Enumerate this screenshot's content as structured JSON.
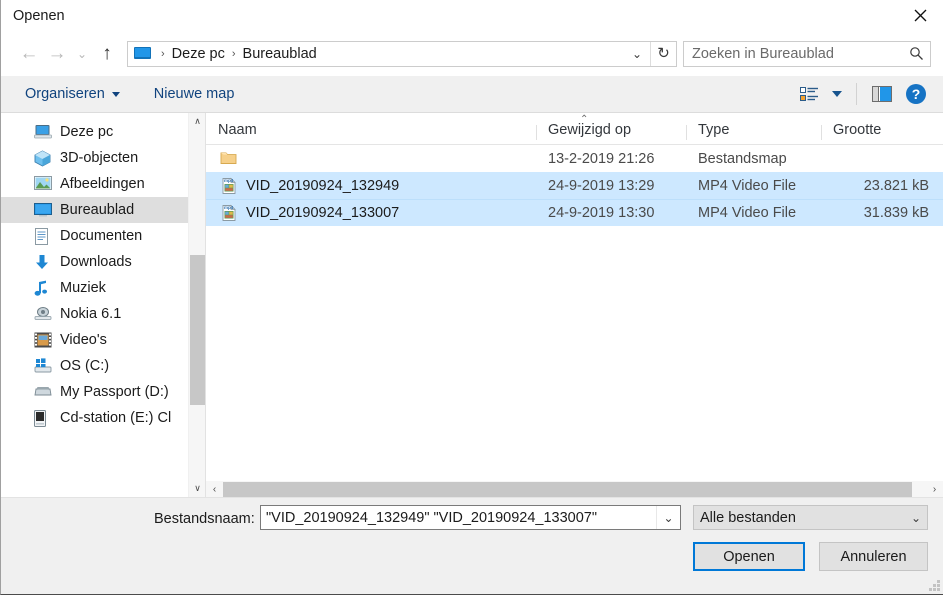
{
  "window": {
    "title": "Openen",
    "close_label": "✕"
  },
  "nav": {
    "back": {
      "glyph": "←",
      "name": "back-button",
      "enabled": false
    },
    "forward": {
      "glyph": "→",
      "name": "forward-button",
      "enabled": false
    },
    "recent": {
      "glyph": "⌵",
      "name": "recent-locations-button",
      "enabled": false
    },
    "up": {
      "glyph": "↑",
      "name": "up-button",
      "enabled": true
    }
  },
  "address": {
    "icon": "desktop-icon",
    "crumbs": [
      "Deze pc",
      "Bureaublad"
    ],
    "separator": "›",
    "dropdown_glyph": "⌵",
    "refresh_glyph": "↻"
  },
  "search": {
    "placeholder": "Zoeken in Bureaublad",
    "icon": "search-icon"
  },
  "commandbar": {
    "organize_label": "Organiseren",
    "new_folder_label": "Nieuwe map",
    "view_icon": "list-view-icon",
    "view_caret": "▼",
    "preview_icon": "preview-pane-icon",
    "help_icon": "help-icon",
    "help_glyph": "?"
  },
  "sidebar": {
    "items": [
      {
        "label": "Deze pc",
        "icon": "this-pc-icon",
        "selected": false
      },
      {
        "label": "3D-objecten",
        "icon": "3d-objects-icon",
        "selected": false
      },
      {
        "label": "Afbeeldingen",
        "icon": "pictures-icon",
        "selected": false
      },
      {
        "label": "Bureaublad",
        "icon": "desktop-icon",
        "selected": true
      },
      {
        "label": "Documenten",
        "icon": "documents-icon",
        "selected": false
      },
      {
        "label": "Downloads",
        "icon": "downloads-icon",
        "selected": false
      },
      {
        "label": "Muziek",
        "icon": "music-icon",
        "selected": false
      },
      {
        "label": "Nokia 6.1",
        "icon": "phone-icon",
        "selected": false
      },
      {
        "label": "Video's",
        "icon": "videos-icon",
        "selected": false
      },
      {
        "label": "OS (C:)",
        "icon": "windows-drive-icon",
        "selected": false
      },
      {
        "label": "My Passport (D:)",
        "icon": "external-drive-icon",
        "selected": false
      },
      {
        "label": "Cd-station (E:) Cl",
        "icon": "cd-drive-icon",
        "selected": false
      }
    ],
    "scrollbar": {
      "up_glyph": "∧",
      "down_glyph": "∨",
      "thumb_top_pct": 37,
      "thumb_height_pct": 39
    }
  },
  "filelist": {
    "columns": [
      {
        "key": "naam",
        "label": "Naam"
      },
      {
        "key": "gew",
        "label": "Gewijzigd op"
      },
      {
        "key": "type",
        "label": "Type"
      },
      {
        "key": "size",
        "label": "Grootte"
      }
    ],
    "sort_indicator": "⌃",
    "sort_column": "Naam",
    "rows": [
      {
        "name": "",
        "icon": "folder-icon",
        "modified": "13-2-2019 21:26",
        "type": "Bestandsmap",
        "size": "",
        "selected": false
      },
      {
        "name": "VID_20190924_132949",
        "icon": "mp4-file-icon",
        "modified": "24-9-2019 13:29",
        "type": "MP4 Video File",
        "size": "23.821 kB",
        "selected": true
      },
      {
        "name": "VID_20190924_133007",
        "icon": "mp4-file-icon",
        "modified": "24-9-2019 13:30",
        "type": "MP4 Video File",
        "size": "31.839 kB",
        "selected": true
      }
    ],
    "hscrollbar": {
      "left_glyph": "‹",
      "right_glyph": "›"
    }
  },
  "footer": {
    "filename_label": "Bestandsnaam:",
    "filename_value": "\"VID_20190924_132949\" \"VID_20190924_133007\"",
    "filename_caret": "⌵",
    "filter_value": "Alle bestanden",
    "filter_caret": "⌵",
    "open_label": "Openen",
    "cancel_label": "Annuleren"
  },
  "colors": {
    "accent": "#0078d7",
    "selection": "#cde8ff",
    "sidebar_selection": "#dedede",
    "link": "#10437e",
    "chrome": "#f0f0f0"
  }
}
